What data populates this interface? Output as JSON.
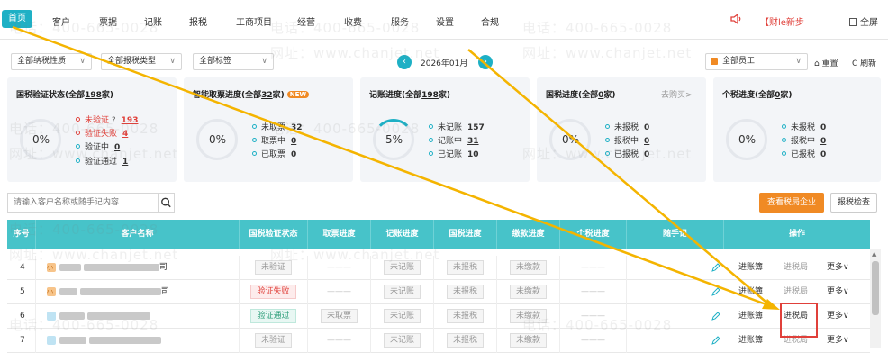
{
  "nav": {
    "home": "首页",
    "items": [
      "客户",
      "票据",
      "记账",
      "报税",
      "工商项目",
      "经营",
      "收费",
      "服务",
      "设置",
      "合规"
    ],
    "news": "【财le新步",
    "fullscreen": "全屏"
  },
  "filters": {
    "tax_nature": "全部纳税性质",
    "tax_type": "全部报税类型",
    "tags": "全部标签",
    "month": "2026年01月",
    "staff": "全部员工",
    "reset": "重置",
    "refresh": "刷新"
  },
  "cards": [
    {
      "title_pre": "国税验证状态(全部",
      "count": "198",
      "title_post": "家)",
      "pct": "0%",
      "stats": [
        {
          "label": "未验证",
          "help": "?",
          "value": "193",
          "red": true
        },
        {
          "label": "验证失败",
          "value": "4",
          "red": true
        },
        {
          "label": "验证中",
          "value": "0",
          "red": false
        },
        {
          "label": "验证通过",
          "value": "1",
          "red": false
        }
      ]
    },
    {
      "title_pre": "智能取票进度(全部",
      "count": "32",
      "title_post": "家)",
      "badge": "NEW",
      "pct": "0%",
      "stats": [
        {
          "label": "未取票",
          "value": "32"
        },
        {
          "label": "取票中",
          "value": "0"
        },
        {
          "label": "已取票",
          "value": "0"
        }
      ]
    },
    {
      "title_pre": "记账进度(全部",
      "count": "198",
      "title_post": "家)",
      "pct": "5%",
      "progress": 5,
      "stats": [
        {
          "label": "未记账",
          "value": "157"
        },
        {
          "label": "记账中",
          "value": "31"
        },
        {
          "label": "已记账",
          "value": "10"
        }
      ]
    },
    {
      "title_pre": "国税进度(全部",
      "count": "0",
      "title_post": "家)",
      "pct": "0%",
      "buy": "去购买>",
      "stats": [
        {
          "label": "未报税",
          "value": "0"
        },
        {
          "label": "报税中",
          "value": "0"
        },
        {
          "label": "已报税",
          "value": "0"
        }
      ]
    },
    {
      "title_pre": "个税进度(全部",
      "count": "0",
      "title_post": "家)",
      "pct": "0%",
      "stats": [
        {
          "label": "未报税",
          "value": "0"
        },
        {
          "label": "报税中",
          "value": "0"
        },
        {
          "label": "已报税",
          "value": "0"
        }
      ]
    }
  ],
  "search": {
    "placeholder": "请输入客户名称或随手记内容"
  },
  "actions": {
    "view_tax_bureau": "查看税局企业",
    "tax_check": "报税检查"
  },
  "table": {
    "headers": [
      "序号",
      "客户名称",
      "国税验证状态",
      "取票进度",
      "记账进度",
      "国税进度",
      "缴款进度",
      "个税进度",
      "随手记",
      "操作"
    ],
    "rows": [
      {
        "no": "4",
        "suffix": "司",
        "verify": "未验证",
        "verify_style": "grey",
        "ticket": "———",
        "book": "未记账",
        "national": "未报税",
        "pay": "未缴款",
        "personal": "———"
      },
      {
        "no": "5",
        "suffix": "司",
        "verify": "验证失败",
        "verify_style": "red",
        "ticket": "———",
        "book": "未记账",
        "national": "未报税",
        "pay": "未缴款",
        "personal": "———"
      },
      {
        "no": "6",
        "suffix": "",
        "verify": "验证通过",
        "verify_style": "green",
        "ticket": "未取票",
        "book": "未记账",
        "national": "未报税",
        "pay": "未缴款",
        "personal": "———"
      },
      {
        "no": "7",
        "suffix": "",
        "verify": "未验证",
        "verify_style": "grey",
        "ticket": "———",
        "book": "未记账",
        "national": "未报税",
        "pay": "未缴款",
        "personal": "———"
      }
    ],
    "ops": {
      "books": "进账簿",
      "bureau": "进税局",
      "more": "更多∨"
    }
  },
  "watermark": {
    "phone": "电话：400-665-0028",
    "site": "网址：www.chanjet.net"
  },
  "colors": {
    "accent": "#1eb0c5",
    "header": "#47c3c9",
    "orange": "#f08a24",
    "red": "#e0403a",
    "arrow": "#f4b400"
  }
}
